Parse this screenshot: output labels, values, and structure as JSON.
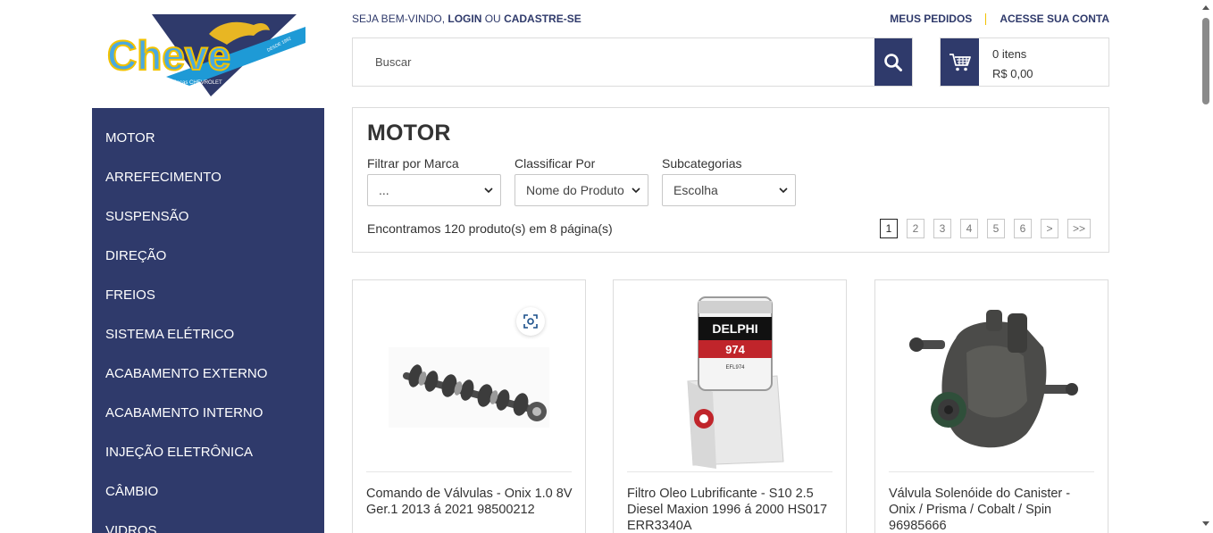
{
  "logo": {
    "brand": "Cheve",
    "tagline": "Especialista em Peças CHEVROLET",
    "since": "DESDE 1992"
  },
  "header": {
    "welcome_prefix": "SEJA BEM-VINDO,",
    "login": "LOGIN",
    "or": "OU",
    "register": "CADASTRE-SE",
    "my_orders": "MEUS PEDIDOS",
    "my_account": "ACESSE SUA CONTA"
  },
  "search": {
    "placeholder": "Buscar",
    "icon": "search-icon"
  },
  "cart": {
    "items": "0 itens",
    "total": "R$ 0,00",
    "icon": "cart-icon"
  },
  "sidebar": {
    "items": [
      {
        "label": "MOTOR"
      },
      {
        "label": "ARREFECIMENTO"
      },
      {
        "label": "SUSPENSÃO"
      },
      {
        "label": "DIREÇÃO"
      },
      {
        "label": "FREIOS"
      },
      {
        "label": "SISTEMA ELÉTRICO"
      },
      {
        "label": "ACABAMENTO EXTERNO"
      },
      {
        "label": "ACABAMENTO INTERNO"
      },
      {
        "label": "INJEÇÃO ELETRÔNICA"
      },
      {
        "label": "CÂMBIO"
      },
      {
        "label": "VIDROS"
      }
    ]
  },
  "category": {
    "title": "MOTOR",
    "filters": [
      {
        "label": "Filtrar por Marca",
        "value": "..."
      },
      {
        "label": "Classificar Por",
        "value": "Nome do Produto"
      },
      {
        "label": "Subcategorias",
        "value": "Escolha"
      }
    ],
    "found": "Encontramos 120 produto(s) em 8 página(s)",
    "pages": [
      "1",
      "2",
      "3",
      "4",
      "5",
      "6",
      ">",
      ">>"
    ]
  },
  "products": [
    {
      "title": "Comando de Válvulas - Onix 1.0 8V Ger.1 2013 á 2021 98500212"
    },
    {
      "title": "Filtro Oleo Lubrificante - S10 2.5 Diesel Maxion 1996 á 2000 HS017 ERR3340A",
      "img_text_1": "DELPHI",
      "img_text_2": "974",
      "img_text_3": "EFL974"
    },
    {
      "title": "Válvula Solenóide do Canister - Onix / Prisma / Cobalt / Spin 96985666"
    }
  ],
  "colors": {
    "primary": "#2f3a6b",
    "accent": "#f2c200",
    "logo_blue": "#1e9ad6"
  }
}
